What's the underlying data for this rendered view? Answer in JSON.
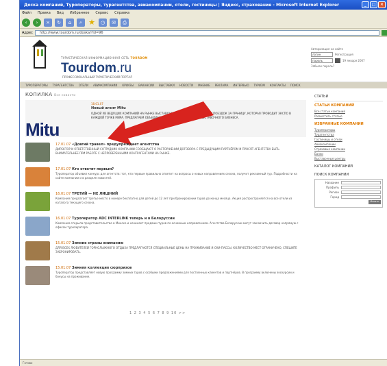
{
  "window": {
    "title": "Доска компаний, Туроператоры, турагентства, авиакомпании, отели, гостиницы | Яндекс, страхование - Microsoft Internet Explorer"
  },
  "menu": [
    "Файл",
    "Правка",
    "Вид",
    "Избранное",
    "Сервис",
    "Справка"
  ],
  "address": {
    "label": "Адрес",
    "value": "http://www.tourdom.ru/doska/?id=96"
  },
  "site": {
    "tagline_pre": "ТУРИСТИЧЕСКАЯ ИНФОРМАЦИОННАЯ СЕТЬ",
    "tagline_accent": "TOURDOM",
    "brand": "Tourdom",
    "brand_suffix": ".ru",
    "subtag": "ПРОФЕССИОНАЛЬНЫЙ ТУРИСТИЧЕСКИЙ ПОРТАЛ"
  },
  "login": {
    "title": "Авторизация на сайте",
    "login_value": "логин",
    "password_value": "пароль",
    "links": [
      "Регистрация",
      "Забыли пароль?"
    ],
    "date": "19 января 2007"
  },
  "nav": [
    "ТУРОПЕРАТОРЫ",
    "ТУРАГЕНТСТВА",
    "ОТЕЛИ",
    "АВИАКОМПАНИИ",
    "КРУИЗЫ",
    "ВАКАНСИИ",
    "ВЫСТАВКИ",
    "НОВОСТИ",
    "МНЕНИЕ",
    "РЕКЛАМА",
    "ИНТЕРВЬЮ",
    "ТУРИЗМ",
    "КОНТАКТЫ",
    "ПОИСК"
  ],
  "section": {
    "title": "КОПИЛКА",
    "sub": "Все новости"
  },
  "feature": {
    "logo": "Mitu",
    "date": "18.01.07",
    "title": "Новый агент Mitu",
    "text": "ОДНОЙ ИЗ ВЕДУЩИХ КОМПАНИЙ НА РЫНКЕ ВЫСТАВОЧНЫХ УСЛУГ И ОРГАНИЗАЦИИ ПОЕЗДОК ЗА ГРАНИЦУ, КОТОРАЯ ПРОВОДИТ ЭКСПО В КАЖДОЙ ТОЧКЕ МИРА. ПРЕДЛАГАЕМ ОБЪЕДИНИТЬ УСИЛИЯ ПО РАЗВИТИЮ ВЫСТАВОЧНОГО БИЗНЕСА."
  },
  "news": [
    {
      "date": "17.01.07",
      "title": "«Довгий травел» предупреждает агентства",
      "text": "ДИРЕКТОР И ОТВЕТСТВЕННЫЙ СОТРУДНИК КОМПАНИИ СООБЩАЮТ О РАСТОРЖЕНИИ ДОГОВОРА С ПРЕДЫДУЩИМ ПАРТНЁРОМ И ПРОСЯТ АГЕНТСТВА БЫТЬ ВНИМАТЕЛЬНЕЕ ПРИ РАБОТЕ С НЕПРОВЕРЕННЫМИ КОНТРАГЕНТАМИ НА РЫНКЕ.",
      "color": "#6d7a64"
    },
    {
      "date": "17.01.07",
      "title": "Кто ответит первым?",
      "text": "Туроператор объявил конкурс для агентств: тот, кто первым правильно ответит на вопросы о новых направлениях сезона, получит рекламный тур. Подробности на сайте компании и в разделе новостей.",
      "color": "#d9823a"
    },
    {
      "date": "16.01.07",
      "title": "ТРЕТИЙ — НЕ ЛИШНИЙ",
      "text": "Компания предлагает третье место в номере бесплатно для детей до 12 лет при бронировании туров до конца месяца. Акция распространяется на все отели из каталога текущего сезона.",
      "color": "#7aa33a"
    },
    {
      "date": "16.01.07",
      "title": "Туроператор ADC INTERLINK теперь и в Белоруссии",
      "text": "Компания открыла представительство в Минске и начинает продажи туров по основным направлениям. Агентства Белоруссии могут заключить договор напрямую с офисом туроператора.",
      "color": "#8aa6c9"
    },
    {
      "date": "15.01.07",
      "title": "Зимние страны вниманию",
      "text": "ДЛЯ ВСЕХ ЛЮБИТЕЛЕЙ ГОРНОЛЫЖНОГО ОТДЫХА ПРЕДЛАГАЮТСЯ СПЕЦИАЛЬНЫЕ ЦЕНЫ НА ПРОЖИВАНИЕ И СКИ-ПАССЫ. КОЛИЧЕСТВО МЕСТ ОГРАНИЧЕНО, СПЕШИТЕ ЗАБРОНИРОВАТЬ.",
      "color": "#a07a4a"
    },
    {
      "date": "15.01.07",
      "title": "Зимняя коллекция сюрпризов",
      "text": "Туроператор представляет новую программу зимних туров с особыми предложениями для постоянных клиентов и партнёров. В программу включены экскурсии и бонусы на проживание.",
      "color": "#9a8a7a"
    }
  ],
  "pager": "1 2 3 4 5 6 7 8 9 10 >>",
  "right": {
    "top_link": "СТАТЬИ",
    "companies_head": "СТАТЬИ КОМПАНИЙ",
    "companies_links": [
      "Все статьи компаний",
      "Разместить статью"
    ],
    "featured_head": "ИЗБРАННЫЕ КОМПАНИИ",
    "featured_links": [
      "Туроператоры",
      "Турагентства",
      "Гостиницы и отели",
      "Авиакомпании",
      "Страховые компании",
      "Банки",
      "Выставочные центры"
    ],
    "catalog": "КАТАЛОГ КОМПАНИЙ",
    "search_head": "ПОИСК КОМПАНИИ",
    "search_fields": [
      "Название",
      "Профиль",
      "Регион",
      "Город"
    ],
    "search_button": "Искать"
  },
  "status": "Готово"
}
